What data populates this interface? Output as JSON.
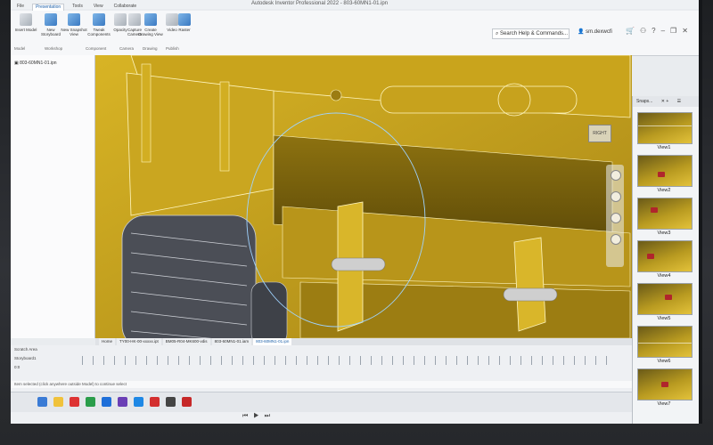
{
  "window": {
    "title": "Autodesk Inventor Professional 2022 - 803-60MN1-01.ipn",
    "search_placeholder": "Search Help & Commands...",
    "user": "sm.dexwcfi"
  },
  "ribbon": {
    "tabs": [
      "File",
      "Presentation",
      "Tools",
      "View",
      "Collaborate"
    ],
    "active_tab": "Presentation",
    "buttons": [
      {
        "label": "Insert Model",
        "icon": "insert-model-icon"
      },
      {
        "label": "New Storyboard",
        "icon": "new-storyboard-icon"
      },
      {
        "label": "New Snapshot View",
        "icon": "new-snapshot-icon"
      },
      {
        "label": "Tweak Components",
        "icon": "tweak-components-icon"
      },
      {
        "label": "Opacity",
        "icon": "opacity-icon"
      },
      {
        "label": "Capture Camera",
        "icon": "capture-camera-icon"
      },
      {
        "label": "Create Drawing View",
        "icon": "create-drawing-view-icon"
      },
      {
        "label": "Video",
        "icon": "video-icon"
      },
      {
        "label": "Raster",
        "icon": "raster-icon"
      }
    ],
    "groups": [
      "Model",
      "Workshop",
      "Component",
      "Camera",
      "Drawing",
      "Publish"
    ]
  },
  "browser": {
    "root_node": "803-60MN1-01.ipn"
  },
  "document_tabs": [
    "Home",
    "TY00-HK-00-xxxxx.ipt",
    "BM05-R04-MK600-vdis",
    "803-60MN1-01.iam",
    "803-60MN1-01.ipn"
  ],
  "active_document": "803-60MN1-01.ipn",
  "viewcube": {
    "label": "RIGHT"
  },
  "snapshots": {
    "title": "Snaps...",
    "views": [
      "View1",
      "View2",
      "View3",
      "View4",
      "View5",
      "View6",
      "View7"
    ]
  },
  "lower": {
    "storyboard_label": "Storyboard1",
    "scratch_label": "Scratch Area",
    "time_label": "0:0",
    "status": "Item selected (click anywhere outside Model) to continue select"
  },
  "colors": {
    "model_yellow": "#c9a41c",
    "model_shadow": "#6e5a0e",
    "tire": "#4b4e56",
    "accent_blue": "#1c5fa8"
  }
}
